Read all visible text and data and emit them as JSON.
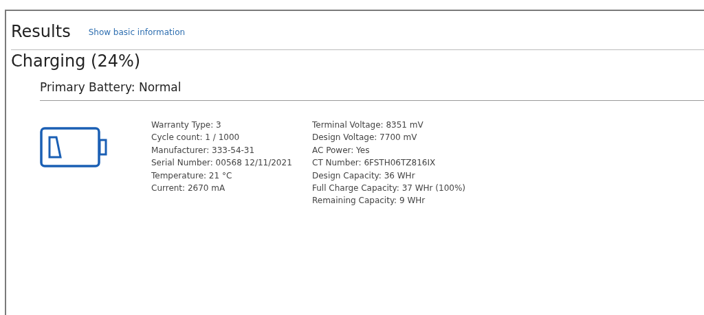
{
  "header": {
    "title": "Results",
    "link": "Show basic information"
  },
  "status": "Charging (24%)",
  "battery": {
    "title": "Primary Battery: Normal",
    "column_1": [
      "Warranty Type: 3",
      "Cycle count: 1 / 1000",
      "Manufacturer: 333-54-31",
      "Serial Number: 00568 12/11/2021",
      "Temperature: 21 °C",
      "Current: 2670 mA"
    ],
    "column_2": [
      "Terminal Voltage: 8351 mV",
      "Design Voltage: 7700 mV",
      "AC Power: Yes",
      "CT Number: 6FSTH06TZ816IX",
      "Design Capacity: 36 WHr",
      "Full Charge Capacity: 37 WHr (100%)",
      "Remaining Capacity: 9 WHr"
    ]
  }
}
